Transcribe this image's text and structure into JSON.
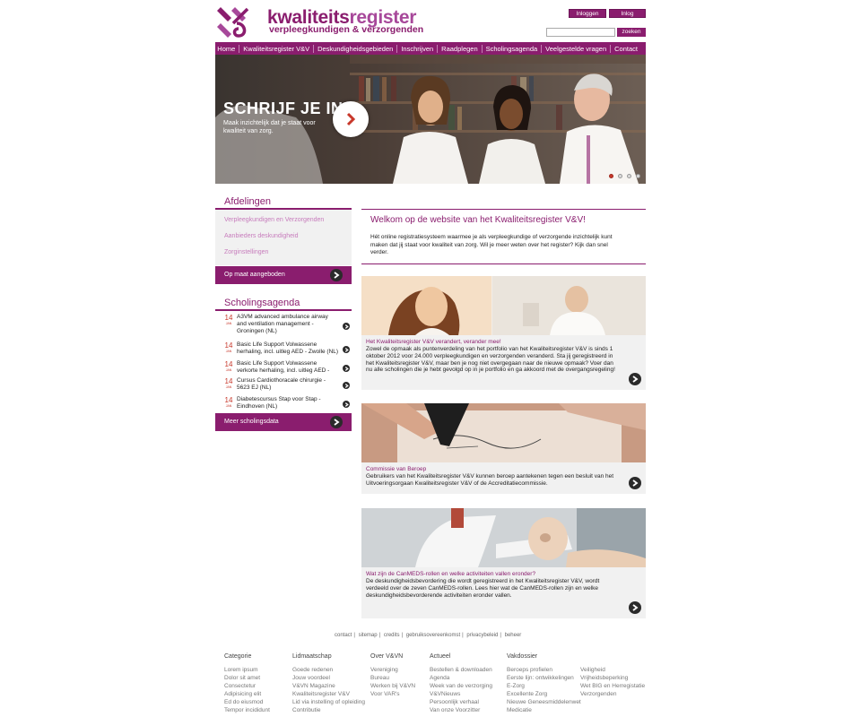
{
  "header": {
    "logo_main": "kwaliteits",
    "logo_main2": "register",
    "logo_sub": "verpleegkundigen & verzorgenden",
    "login_label": "Inloggen",
    "forgot_label": "Inlog vergeten?",
    "search_placeholder": "",
    "search_button": "zoeken"
  },
  "nav": [
    "Home",
    "Kwaliteitsregister V&V",
    "Deskundigheidsgebieden",
    "Inschrijven",
    "Raadplegen",
    "Scholingsagenda",
    "Veelgestelde vragen",
    "Contact"
  ],
  "hero": {
    "title": "SCHRIJF JE IN!",
    "text": "Maak inzichtelijk dat je staat voor kwaliteit van zorg.",
    "active_slide": 1,
    "slides": 4
  },
  "afdelingen": {
    "heading": "Afdelingen",
    "links": [
      "Verpleegkundigen en Verzorgenden",
      "Aanbieders deskundigheid",
      "Zorginstellingen"
    ],
    "cta": "Op maat aangeboden"
  },
  "scholing": {
    "heading": "Scholingsagenda",
    "events": [
      {
        "day": "14",
        "month": "JAN",
        "text": "A3VM advanced ambulance airway and ventilation management - Groningen (NL)"
      },
      {
        "day": "14",
        "month": "JAN",
        "text": "Basic Life Support Volwassene herhaling, incl. uitleg AED - Zwolle (NL)"
      },
      {
        "day": "14",
        "month": "JAN",
        "text": "Basic Life Support Volwassene verkorte herhaling, incl. uitleg AED -"
      },
      {
        "day": "14",
        "month": "JAN",
        "text": "Cursus Cardiothoracale chirurgie - 5623 EJ (NL)"
      },
      {
        "day": "14",
        "month": "JAN",
        "text": "Diabetescursus Stap voor Stap - Eindhoven (NL)"
      }
    ],
    "cta": "Meer scholingsdata"
  },
  "welcome": {
    "title": "Welkom op de website van het Kwaliteitsregister V&V!",
    "text": "Hét online registratiesysteem waarmee je als verpleegkundige of verzorgende inzichtelijk kunt maken dat jij staat voor kwaliteit van zorg. Wil je meer weten over het register? Kijk dan snel verder."
  },
  "cards": [
    {
      "title": "Het Kwaliteitsregister V&V verandert, verander mee!",
      "text": "Zowel de opmaak als puntenverdeling van het portfolio van het Kwaliteitsregister V&V is sinds 1 oktober 2012 voor 24.000 verpleegkundigen en verzorgenden veranderd. Sta jij geregistreerd in het Kwaliteitsregister V&V, maar ben je nog niet overgegaan naar de nieuwe opmaak? Voer dan nu alle scholingen die je hebt gevolgd op in je portfolio en ga akkoord met de overgangsregeling!"
    },
    {
      "title": "Commissie van Beroep",
      "text": "Gebruikers van het Kwaliteitsregister V&V kunnen beroep aantekenen tegen een besluit van het Uitvoeringsorgaan Kwaliteitsregister V&V of de Accreditatiecommissie."
    },
    {
      "title": "Wat zijn de CanMEDS-rollen en welke activiteiten vallen eronder?",
      "text": "De deskundigheidsbevordering die wordt geregistreerd in het Kwaliteitsregister V&V, wordt verdeeld over de zeven CanMEDS-rollen. Lees hier wat de CanMEDS-rollen zijn en welke deskundigheidsbevorderende activiteiten eronder vallen."
    }
  ],
  "footer": {
    "links": [
      "contact",
      "sitemap",
      "credits",
      "gebruiksovereenkomst",
      "privacybeleid",
      "beheer"
    ],
    "columns": [
      {
        "heading": "Categorie",
        "items": [
          "Lorem ipsum",
          "Dolor sit amet",
          "Consectetur",
          "Adipisicing elit",
          "Ed do eiusmod",
          "Tempor incididunt"
        ]
      },
      {
        "heading": "Lidmaatschap",
        "items": [
          "Goede redenen",
          "Jouw voordeel",
          "V&VN Magazine",
          "Kwaliteitsregister V&V",
          "Lid via instelling of opleiding",
          "Contributie"
        ]
      },
      {
        "heading": "Over V&VN",
        "items": [
          "Vereniging",
          "Bureau",
          "Werken bij V&VN",
          "Voor VAR's"
        ]
      },
      {
        "heading": "Actueel",
        "items": [
          "Bestellen & downloaden",
          "Agenda",
          "Week van de verzorging",
          "V&VNieuws",
          "Persoonlijk verhaal",
          "Van onze Voorzitter"
        ]
      },
      {
        "heading": "Vakdossier",
        "items": [
          "Beroeps profielen",
          "Eerste lijn: ontwikkelingen",
          "E-Zorg",
          "Excellente Zorg",
          "Nieuwe Geneesmiddelenwet",
          "Medicatie"
        ]
      },
      {
        "heading": "",
        "items": [
          "Veiligheid",
          "Vrijheidsbeperking",
          "Wet BIG en Herregistatie",
          "Verzorgenden"
        ]
      }
    ]
  },
  "colors": {
    "brand": "#8a1d6e",
    "accent": "#c8382b",
    "panel": "#f1f1f1"
  }
}
